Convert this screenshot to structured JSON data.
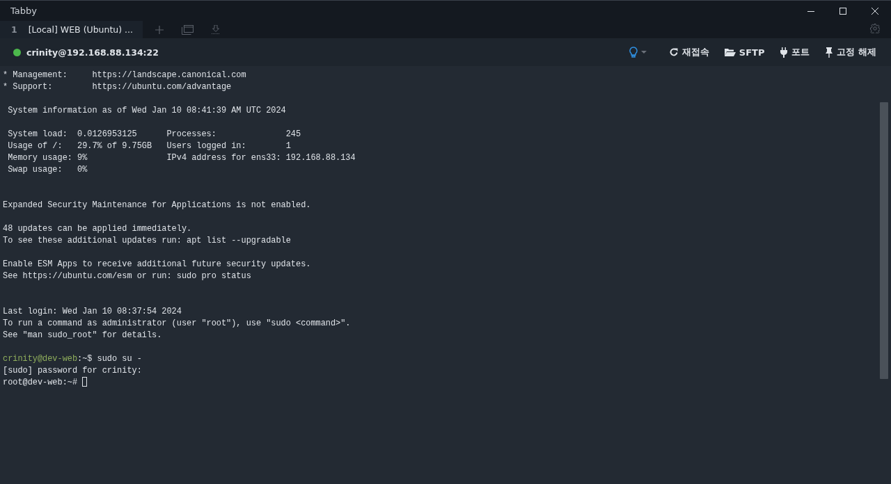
{
  "window": {
    "title": "Tabby"
  },
  "tabs": [
    {
      "number": "1",
      "label": "[Local] WEB (Ubuntu) ...",
      "selected": true
    }
  ],
  "connection": {
    "label": "crinity@192.168.88.134:22",
    "connected": true
  },
  "toolbar": [
    {
      "kind": "hint"
    },
    {
      "kind": "reconnect",
      "label": "재접속"
    },
    {
      "kind": "sftp",
      "label": "SFTP"
    },
    {
      "kind": "ports",
      "label": "포트"
    },
    {
      "kind": "unpin",
      "label": "고정 해제"
    }
  ],
  "terminal": {
    "lines": [
      {
        "kind": "text",
        "text": "* Management:     https://landscape.canonical.com"
      },
      {
        "kind": "text",
        "text": "* Support:        https://ubuntu.com/advantage"
      },
      {
        "kind": "blank"
      },
      {
        "kind": "text",
        "text": " System information as of Wed Jan 10 08:41:39 AM UTC 2024"
      },
      {
        "kind": "blank"
      },
      {
        "kind": "text",
        "text": " System load:  0.0126953125      Processes:              245"
      },
      {
        "kind": "text",
        "text": " Usage of /:   29.7% of 9.75GB   Users logged in:        1"
      },
      {
        "kind": "text",
        "text": " Memory usage: 9%                IPv4 address for ens33: 192.168.88.134"
      },
      {
        "kind": "text",
        "text": " Swap usage:   0%"
      },
      {
        "kind": "blank"
      },
      {
        "kind": "blank"
      },
      {
        "kind": "text",
        "text": "Expanded Security Maintenance for Applications is not enabled."
      },
      {
        "kind": "blank"
      },
      {
        "kind": "text",
        "text": "48 updates can be applied immediately."
      },
      {
        "kind": "text",
        "text": "To see these additional updates run: apt list --upgradable"
      },
      {
        "kind": "blank"
      },
      {
        "kind": "text",
        "text": "Enable ESM Apps to receive additional future security updates."
      },
      {
        "kind": "text",
        "text": "See https://ubuntu.com/esm or run: sudo pro status"
      },
      {
        "kind": "blank"
      },
      {
        "kind": "blank"
      },
      {
        "kind": "text",
        "text": "Last login: Wed Jan 10 08:37:54 2024"
      },
      {
        "kind": "text",
        "text": "To run a command as administrator (user \"root\"), use \"sudo <command>\"."
      },
      {
        "kind": "text",
        "text": "See \"man sudo_root\" for details."
      },
      {
        "kind": "blank"
      },
      {
        "kind": "prompt",
        "prompt": "crinity@dev-web",
        "text": ":~$ sudo su -"
      },
      {
        "kind": "text",
        "text": "[sudo] password for crinity:"
      },
      {
        "kind": "text",
        "text": "root@dev-web:~# ",
        "cursor": true
      }
    ]
  }
}
